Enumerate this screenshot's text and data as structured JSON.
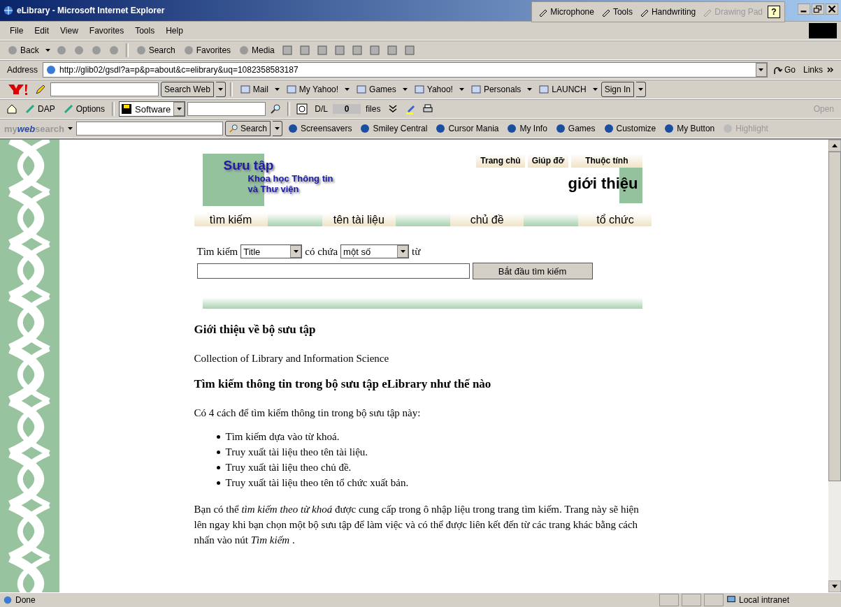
{
  "window": {
    "title": "eLibrary - Microsoft Internet Explorer"
  },
  "help_button": "?",
  "language_bar": [
    {
      "label": "Microphone",
      "disabled": false
    },
    {
      "label": "Tools",
      "disabled": false
    },
    {
      "label": "Handwriting",
      "disabled": false
    },
    {
      "label": "Drawing Pad",
      "disabled": true
    }
  ],
  "menu": [
    "File",
    "Edit",
    "View",
    "Favorites",
    "Tools",
    "Help"
  ],
  "standard_buttons": [
    {
      "label": "Back",
      "dropdown": true
    },
    {
      "label": "Search",
      "dropdown": false
    },
    {
      "label": "Favorites",
      "dropdown": false
    },
    {
      "label": "Media",
      "dropdown": false
    }
  ],
  "address": {
    "label": "Address",
    "url": "http://glib02/gsdl?a=p&p=about&c=elibrary&uq=1082358583187",
    "go": "Go",
    "links": "Links"
  },
  "yahoo_toolbar": {
    "search_button": "Search Web",
    "items": [
      {
        "label": "Mail"
      },
      {
        "label": "My Yahoo!"
      },
      {
        "label": "Games"
      },
      {
        "label": "Yahoo!"
      },
      {
        "label": "Personals"
      },
      {
        "label": "LAUNCH"
      }
    ],
    "sign_in": "Sign In"
  },
  "dap_toolbar": {
    "items": [
      "DAP",
      "Options"
    ],
    "category": "Software",
    "dl_label": "D/L",
    "dl_value": "0",
    "files": "files",
    "open": "Open"
  },
  "mywebsearch_toolbar": {
    "logo": [
      "my",
      "web",
      "search"
    ],
    "search_button": "Search",
    "items": [
      {
        "label": "Screensavers",
        "disabled": false
      },
      {
        "label": "Smiley Central",
        "disabled": false
      },
      {
        "label": "Cursor Mania",
        "disabled": false
      },
      {
        "label": "My Info",
        "disabled": false
      },
      {
        "label": "Games",
        "disabled": false
      },
      {
        "label": "Customize",
        "disabled": false
      },
      {
        "label": "My Button",
        "disabled": false
      },
      {
        "label": "Highlight",
        "disabled": true
      }
    ]
  },
  "page": {
    "collection_title": "Sưu tập",
    "collection_subtitle": [
      "Khoa học Thông tin",
      "và Thư viện"
    ],
    "top_links": [
      "Trang chủ",
      "Giúp đỡ",
      "Thuộc tính"
    ],
    "page_title": "giới thiệu",
    "nav_tabs": [
      "tìm kiếm",
      "tên tài liệu",
      "chủ đề",
      "tổ chức"
    ],
    "search_form": {
      "label": "Tìm kiếm",
      "field": "Title",
      "contains": "có chứa",
      "mode": "một số",
      "word": "từ",
      "button": "Bắt đầu tìm kiếm"
    },
    "sections": [
      {
        "heading": "Giới thiệu về bộ sưu tập",
        "paragraphs": [
          "Collection of Library and Information Science"
        ]
      },
      {
        "heading": "Tìm kiếm thông tin trong bộ sưu tập eLibrary như thế nào",
        "paragraphs": [
          "Có 4 cách để tìm kiếm thông tin trong bộ sưu tập này:"
        ],
        "bullets": [
          "Tìm kiếm dựa vào từ khoá.",
          "Truy xuất tài liệu theo tên tài liệu.",
          "Truy xuất tài liệu theo chủ đề.",
          "Truy xuất tài liệu theo tên tổ chức xuất bản."
        ],
        "closing": "Bạn có thể *tìm kiếm theo từ khoá* được cung cấp trong ô nhập liệu trong trang tìm kiếm. Trang này sẽ hiện lên ngay khi bạn chọn một bộ sưu tập để làm việc và có thể được liên kết đến từ các trang khác bằng cách nhấn vào nút *Tìm kiếm* ."
      }
    ]
  },
  "status_bar": {
    "text": "Done",
    "zone": "Local intranet"
  }
}
